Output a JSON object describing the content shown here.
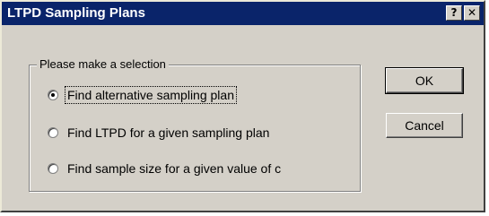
{
  "window": {
    "title": "LTPD Sampling Plans",
    "help_button": "?",
    "close_button": "✕"
  },
  "group": {
    "legend": "Please make a selection",
    "options": [
      {
        "label": "Find alternative sampling plan",
        "selected": true
      },
      {
        "label": "Find LTPD for a given sampling plan",
        "selected": false
      },
      {
        "label": "Find sample size for a given value of c",
        "selected": false
      }
    ]
  },
  "buttons": {
    "ok": "OK",
    "cancel": "Cancel"
  },
  "colors": {
    "titlebar": "#0a246a",
    "face": "#d4d0c8"
  }
}
